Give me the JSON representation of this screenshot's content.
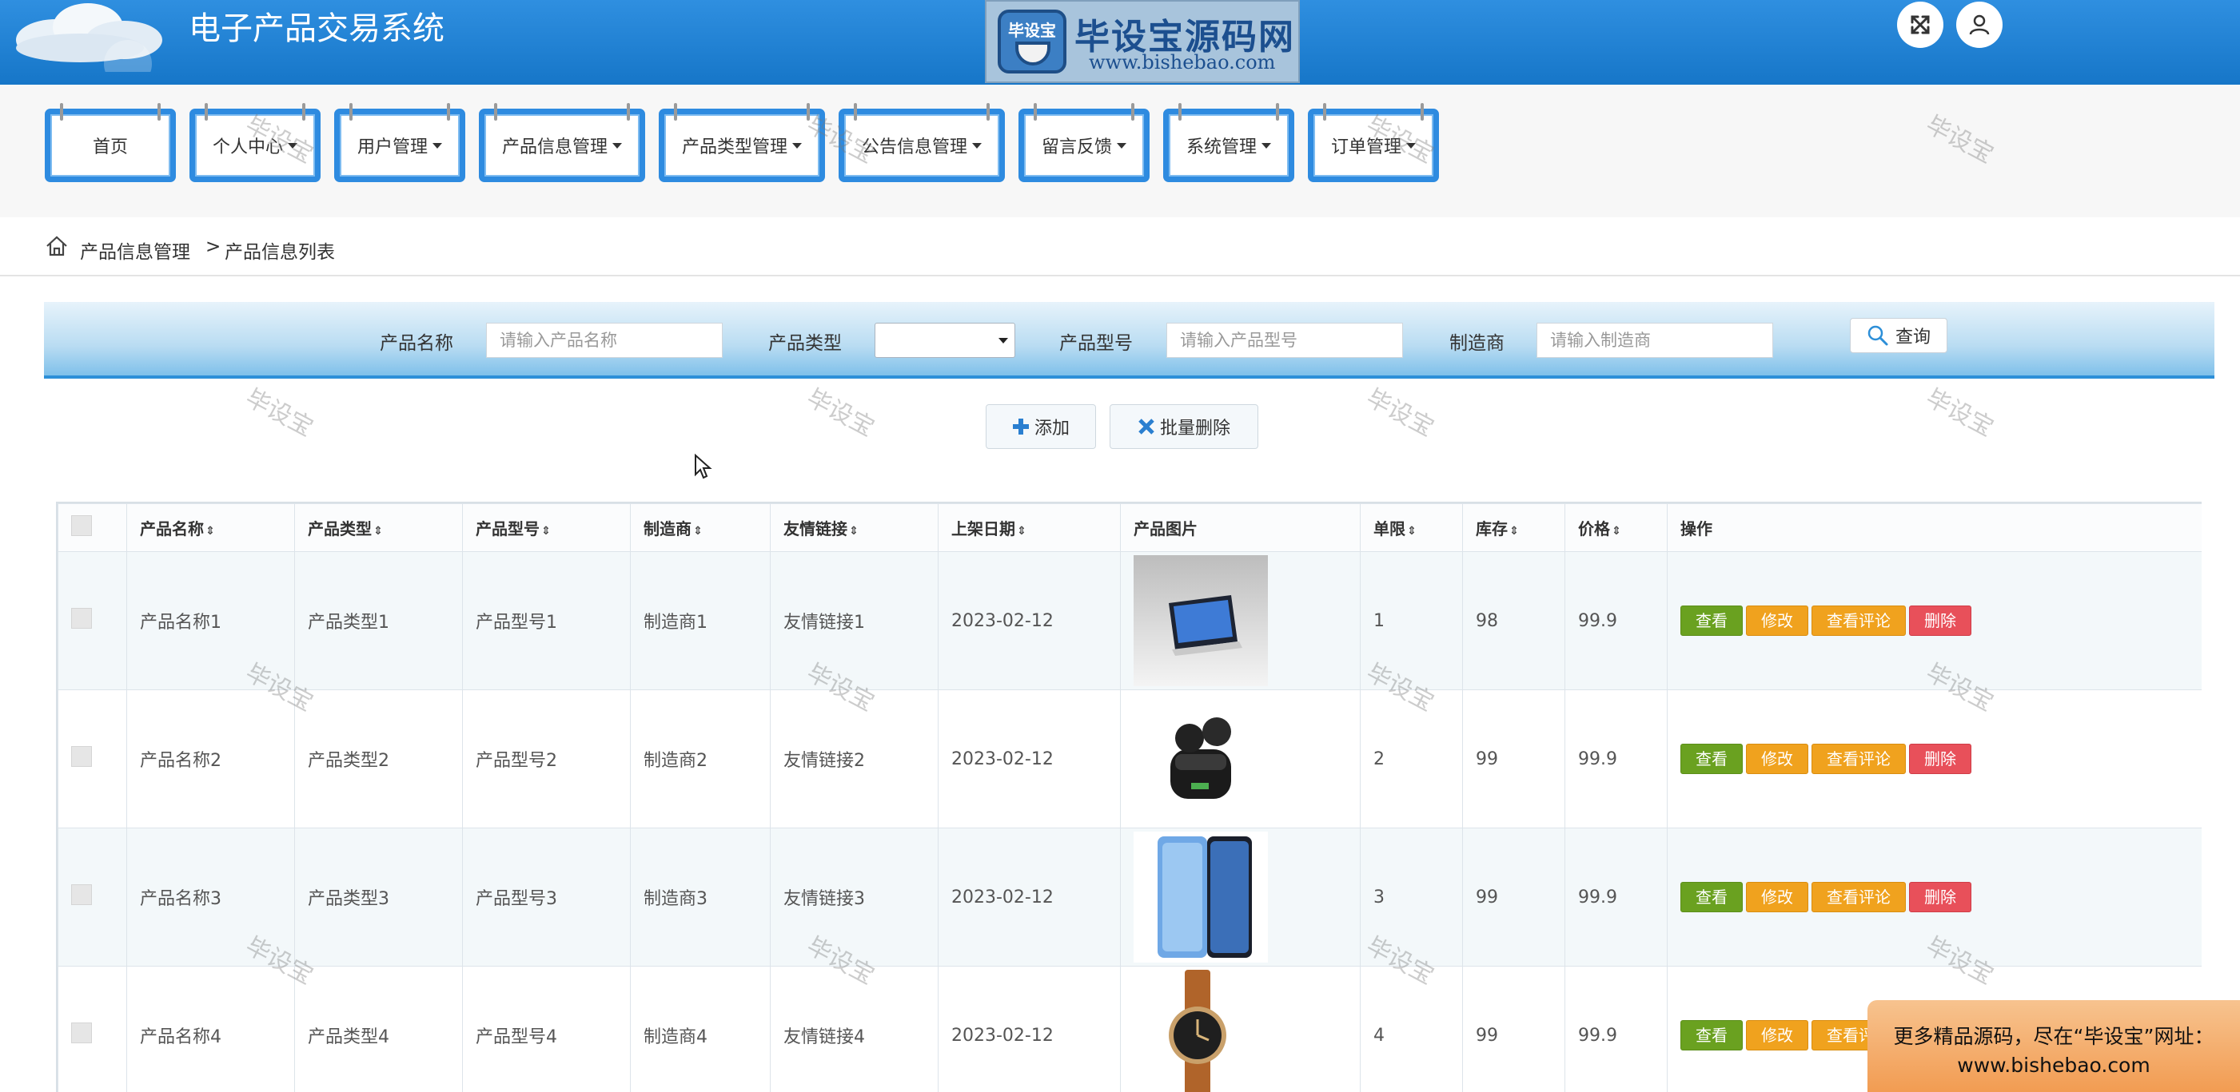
{
  "header": {
    "title": "电子产品交易系统",
    "logo_badge": "毕设宝",
    "logo_name": "毕设宝源码网",
    "logo_url": "www.bishebao.com",
    "icons": [
      "fullscreen-icon",
      "user-icon"
    ]
  },
  "nav": {
    "items": [
      {
        "label": "首页",
        "dropdown": false
      },
      {
        "label": "个人中心",
        "dropdown": true
      },
      {
        "label": "用户管理",
        "dropdown": true
      },
      {
        "label": "产品信息管理",
        "dropdown": true
      },
      {
        "label": "产品类型管理",
        "dropdown": true
      },
      {
        "label": "公告信息管理",
        "dropdown": true
      },
      {
        "label": "留言反馈",
        "dropdown": true
      },
      {
        "label": "系统管理",
        "dropdown": true
      },
      {
        "label": "订单管理",
        "dropdown": true
      }
    ]
  },
  "breadcrumb": {
    "items": [
      "产品信息管理",
      "产品信息列表"
    ],
    "separator": ">"
  },
  "search": {
    "name_label": "产品名称",
    "name_placeholder": "请输入产品名称",
    "type_label": "产品类型",
    "type_value": "",
    "model_label": "产品型号",
    "model_placeholder": "请输入产品型号",
    "maker_label": "制造商",
    "maker_placeholder": "请输入制造商",
    "query_label": "查询"
  },
  "actions": {
    "add_label": "添加",
    "batch_delete_label": "批量删除"
  },
  "table": {
    "columns": [
      "产品名称",
      "产品类型",
      "产品型号",
      "制造商",
      "友情链接",
      "上架日期",
      "产品图片",
      "单限",
      "库存",
      "价格",
      "操作"
    ],
    "sortable": [
      true,
      true,
      true,
      true,
      true,
      true,
      false,
      true,
      true,
      true,
      false
    ],
    "rows": [
      {
        "name": "产品名称1",
        "type": "产品类型1",
        "model": "产品型号1",
        "maker": "制造商1",
        "link": "友情链接1",
        "date": "2023-02-12",
        "image": "tablet",
        "limit": "1",
        "stock": "98",
        "price": "99.9"
      },
      {
        "name": "产品名称2",
        "type": "产品类型2",
        "model": "产品型号2",
        "maker": "制造商2",
        "link": "友情链接2",
        "date": "2023-02-12",
        "image": "earbuds",
        "limit": "2",
        "stock": "99",
        "price": "99.9"
      },
      {
        "name": "产品名称3",
        "type": "产品类型3",
        "model": "产品型号3",
        "maker": "制造商3",
        "link": "友情链接3",
        "date": "2023-02-12",
        "image": "phones",
        "limit": "3",
        "stock": "99",
        "price": "99.9"
      },
      {
        "name": "产品名称4",
        "type": "产品类型4",
        "model": "产品型号4",
        "maker": "制造商4",
        "link": "友情链接4",
        "date": "2023-02-12",
        "image": "watch",
        "limit": "4",
        "stock": "99",
        "price": "99.9"
      }
    ],
    "row_actions": {
      "view": "查看",
      "edit": "修改",
      "review": "查看评论",
      "delete": "删除"
    }
  },
  "watermark": "毕设宝",
  "promo": {
    "line1": "更多精品源码，尽在“毕设宝”网址：",
    "line2": "www.bishebao.com"
  },
  "colors": {
    "header_blue": "#1f82d6",
    "nav_border": "#2e8be0",
    "view_green": "#6aa120",
    "edit_orange": "#f0a21e",
    "delete_red": "#e8505a"
  }
}
